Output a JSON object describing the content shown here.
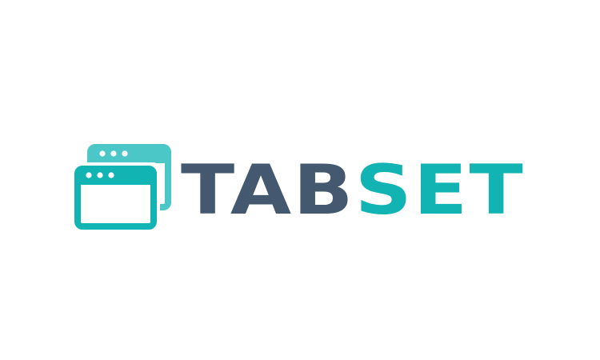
{
  "logo": {
    "word_part_1": "TAB",
    "word_part_2": "SET",
    "icon": "browser-windows-icon"
  },
  "colors": {
    "background": "#ffffff",
    "dark_slate": "#44586f",
    "teal": "#11b3b3",
    "teal_light": "#4cc7c8"
  }
}
